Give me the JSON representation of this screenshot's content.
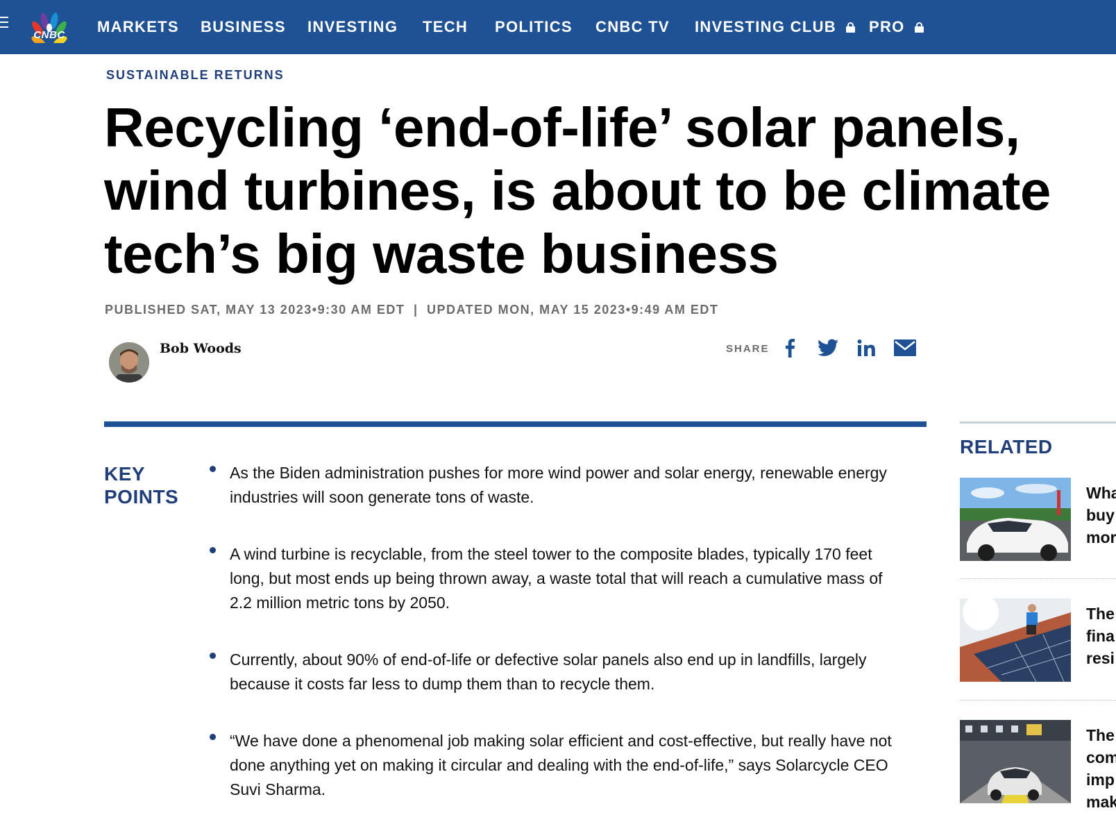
{
  "nav": {
    "brand": "CNBC",
    "items": [
      {
        "label": "MARKETS"
      },
      {
        "label": "BUSINESS"
      },
      {
        "label": "INVESTING"
      },
      {
        "label": "TECH"
      },
      {
        "label": "POLITICS"
      },
      {
        "label": "CNBC TV"
      },
      {
        "label": "INVESTING CLUB",
        "locked": true
      },
      {
        "label": "PRO",
        "locked": true
      }
    ]
  },
  "article": {
    "section": "SUSTAINABLE RETURNS",
    "headline": "Recycling ‘end-of-life’ solar panels, wind turbines, is about to be climate tech’s big waste business",
    "published": "PUBLISHED SAT, MAY 13 2023•9:30 AM EDT",
    "updated": "UPDATED MON, MAY 15 2023•9:49 AM EDT",
    "author": "Bob Woods",
    "share_label": "SHARE",
    "share_icons": [
      "facebook-icon",
      "twitter-icon",
      "linkedin-icon",
      "email-icon"
    ]
  },
  "key_points": {
    "title": "KEY POINTS",
    "items": [
      "As the Biden administration pushes for more wind power and solar energy, renewable energy industries will soon generate tons of waste.",
      "A wind turbine is recyclable, from the steel tower to the composite blades, typically 170 feet long, but most ends up being thrown away, a waste total that will reach a cumulative mass of 2.2 million metric tons by 2050.",
      "Currently, about 90% of end-of-life or defective solar panels also end up in landfills, largely because it costs far less to dump them than to recycle them.",
      "“We have done a phenomenal job making solar efficient and cost-effective, but really have not done anything yet on making it circular and dealing with the end-of-life,” says Solarcycle CEO Suvi Sharma."
    ]
  },
  "related": {
    "title": "RELATED",
    "items": [
      {
        "line1": "Wha",
        "line2": "buy",
        "line3": "mor"
      },
      {
        "line1": "The",
        "line2": "fina",
        "line3": "resi"
      },
      {
        "line1": "The",
        "line2": "com",
        "line3": "imp",
        "line4": "mak"
      }
    ]
  },
  "colors": {
    "nav_bg": "#1f5294",
    "brand_blue": "#1f3e7a",
    "meta_gray": "#6b6b6b"
  }
}
